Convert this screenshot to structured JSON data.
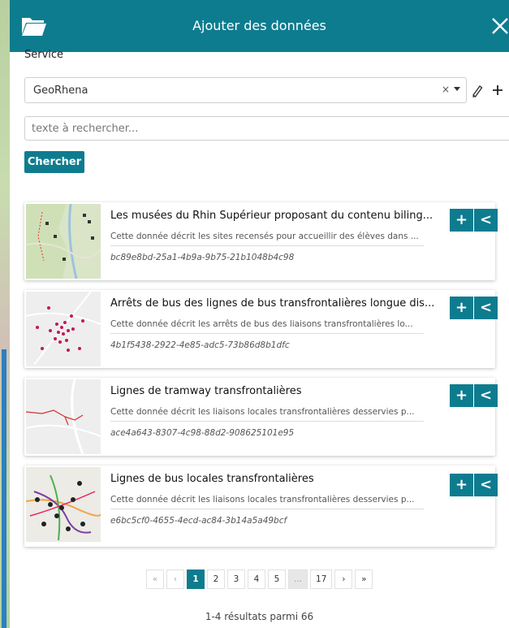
{
  "header": {
    "title": "Ajouter des données",
    "folder_icon": "folder-open-icon",
    "close_icon": "close-icon",
    "color": "#0e7c8f"
  },
  "service": {
    "label": "Service",
    "selected": "GeoRhena",
    "clear_symbol": "×",
    "edit_icon": "pencil-icon",
    "add_icon": "plus-icon"
  },
  "search": {
    "placeholder": "texte à rechercher...",
    "value": "",
    "button_label": "Chercher"
  },
  "results": [
    {
      "title": "Les musées du Rhin Supérieur proposant du contenu biling...",
      "description": "Cette donnée décrit les sites recensés pour accueillir des élèves dans ...",
      "id": "bc89e8bd-25a1-4b9a-9b75-21b1048b4c98"
    },
    {
      "title": "Arrêts de bus des lignes de bus transfrontalières longue dis...",
      "description": "Cette donnée décrit les arrêts de bus des liaisons transfrontalières lo...",
      "id": "4b1f5438-2922-4e85-adc5-73b86d8b1dfc"
    },
    {
      "title": "Lignes de tramway transfrontalières",
      "description": "Cette donnée décrit les liaisons locales transfrontalières desservies p...",
      "id": "ace4a643-8307-4c98-88d2-908625101e95"
    },
    {
      "title": "Lignes de bus locales transfrontalières",
      "description": "Cette donnée décrit les liaisons locales transfrontalières desservies p...",
      "id": "e6bc5cf0-4655-4ecd-ac84-3b14a5a49bcf"
    }
  ],
  "card_buttons": {
    "add": "+",
    "preview": "<"
  },
  "pagination": {
    "first": "«",
    "prev": "‹",
    "pages": [
      "1",
      "2",
      "3",
      "4",
      "5"
    ],
    "ellipsis": "...",
    "last_page": "17",
    "next": "›",
    "last": "»",
    "current": "1"
  },
  "results_count": "1-4 résultats parmi 66"
}
